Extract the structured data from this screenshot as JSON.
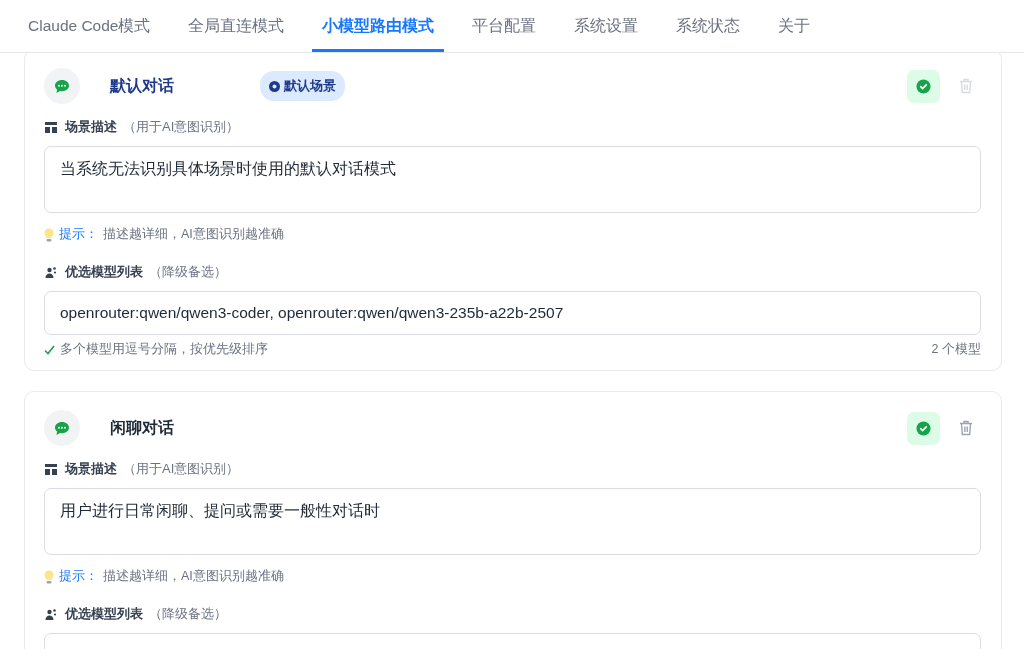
{
  "tabs": [
    {
      "label": "Claude Code模式",
      "selected": false
    },
    {
      "label": "全局直连模式",
      "selected": false
    },
    {
      "label": "小模型路由模式",
      "selected": true
    },
    {
      "label": "平台配置",
      "selected": false
    },
    {
      "label": "系统设置",
      "selected": false
    },
    {
      "label": "系统状态",
      "selected": false
    },
    {
      "label": "关于",
      "selected": false
    }
  ],
  "scenes": [
    {
      "title": "默认对话",
      "default": true,
      "badge": "默认场景",
      "enabled": true,
      "delete_disabled": true,
      "description_label": "场景描述",
      "description_note": "（用于AI意图识别）",
      "description": "当系统无法识别具体场景时使用的默认对话模式",
      "hint_label": "提示：",
      "hint": "描述越详细，AI意图识别越准确",
      "models_label": "优选模型列表",
      "models_note": "（降级备选）",
      "models": "openrouter:qwen/qwen3-coder, openrouter:qwen/qwen3-235b-a22b-2507",
      "models_help": "多个模型用逗号分隔，按优先级排序",
      "models_count": "2 个模型"
    },
    {
      "title": "闲聊对话",
      "default": false,
      "enabled": true,
      "delete_disabled": false,
      "description_label": "场景描述",
      "description_note": "（用于AI意图识别）",
      "description": "用户进行日常闲聊、提问或需要一般性对话时",
      "hint_label": "提示：",
      "hint": "描述越详细，AI意图识别越准确",
      "models_label": "优选模型列表",
      "models_note": "（降级备选）"
    }
  ]
}
